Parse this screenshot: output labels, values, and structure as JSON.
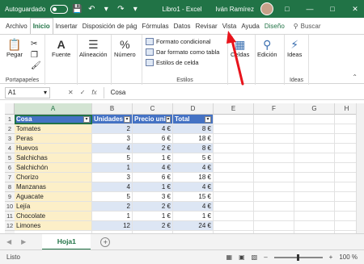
{
  "titlebar": {
    "autosave_label": "Autoguardado",
    "autosave_state": "Desactivado",
    "title": "Libro1 - Excel",
    "username": "Iván Ramírez"
  },
  "tabs": [
    "Archivo",
    "Inicio",
    "Insertar",
    "Disposición de pág",
    "Fórmulas",
    "Datos",
    "Revisar",
    "Vista",
    "Ayuda",
    "Diseño"
  ],
  "active_tab": "Inicio",
  "search_label": "Buscar",
  "ribbon": {
    "paste_label": "Pegar",
    "clipboard_label": "Portapapeles",
    "font_label": "Fuente",
    "alignment_label": "Alineación",
    "number_label": "Número",
    "cond_format_label": "Formato condicional",
    "table_format_label": "Dar formato como tabla",
    "cell_styles_label": "Estilos de celda",
    "styles_label": "Estilos",
    "cells_label": "Celdas",
    "editing_label": "Edición",
    "ideas_label": "Ideas",
    "ideas_group_label": "Ideas"
  },
  "formula_bar": {
    "name_box": "A1",
    "content": "Cosa",
    "fx_label": "fx"
  },
  "columns": [
    "A",
    "B",
    "C",
    "D",
    "E",
    "F",
    "G",
    "H"
  ],
  "table": {
    "headers": [
      "Cosa",
      "Unidades",
      "Precio uni",
      "Total"
    ],
    "rows": [
      [
        "Tomates",
        "2",
        "4 €",
        "8 €"
      ],
      [
        "Peras",
        "3",
        "6 €",
        "18 €"
      ],
      [
        "Huevos",
        "4",
        "2 €",
        "8 €"
      ],
      [
        "Salchichas",
        "5",
        "1 €",
        "5 €"
      ],
      [
        "Salchichón",
        "1",
        "4 €",
        "4 €"
      ],
      [
        "Chorizo",
        "3",
        "6 €",
        "18 €"
      ],
      [
        "Manzanas",
        "4",
        "1 €",
        "4 €"
      ],
      [
        "Aguacate",
        "5",
        "3 €",
        "15 €"
      ],
      [
        "Lejía",
        "2",
        "2 €",
        "4 €"
      ],
      [
        "Chocolate",
        "1",
        "1 €",
        "1 €"
      ],
      [
        "Limones",
        "12",
        "2 €",
        "24 €"
      ]
    ]
  },
  "row_numbers": [
    "1",
    "2",
    "3",
    "4",
    "5",
    "6",
    "7",
    "8",
    "9",
    "10",
    "11",
    "12",
    "13"
  ],
  "sheet_tab": "Hoja1",
  "status": {
    "left": "Listo",
    "zoom": "100 %"
  },
  "colors": {
    "excel_green": "#217346",
    "table_header": "#4472c4",
    "table_band": "#dde6f4",
    "arrow": "#e8141c"
  }
}
